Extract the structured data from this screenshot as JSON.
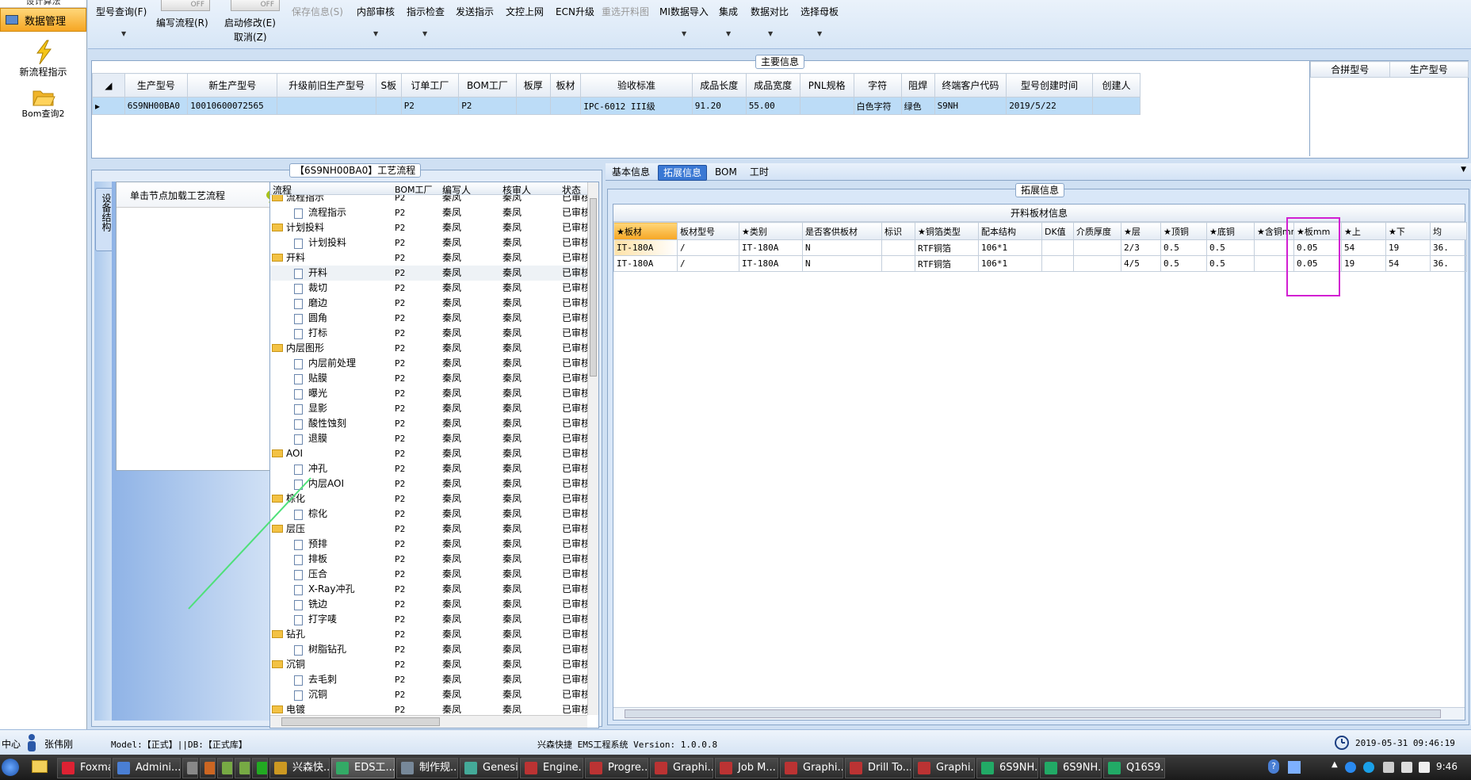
{
  "nav": {
    "top_label": "设计算法",
    "active_label": "数据管理",
    "new_flow_label": "新流程指示",
    "bom_query_label": "Bom查询2"
  },
  "toolbar": {
    "model_query": "型号查询(F)",
    "toggle_off": "OFF",
    "edit_flow": "编写流程(R)",
    "start_edit": "启动修改(E)",
    "cancel": "取消(Z)",
    "save_info": "保存信息(S)",
    "internal_review": "内部审核",
    "instruction_check": "指示检查",
    "send_instruction": "发送指示",
    "doc_upload": "文控上网",
    "ecn_upgrade": "ECN升级",
    "reselect_cut": "重选开料图",
    "mi_import": "MI数据导入",
    "integrate": "集成",
    "data_compare": "数据对比",
    "select_master": "选择母板"
  },
  "main_info": {
    "title": "主要信息",
    "columns": [
      "生产型号",
      "新生产型号",
      "升级前旧生产型号",
      "S板",
      "订单工厂",
      "BOM工厂",
      "板厚",
      "板材",
      "验收标准",
      "成品长度",
      "成品宽度",
      "PNL规格",
      "字符",
      "阻焊",
      "终端客户代码",
      "型号创建时间",
      "创建人"
    ],
    "row": [
      "6S9NH00BA0",
      "10010600072565",
      "",
      "",
      "P2",
      "P2",
      "",
      "",
      "IPC-6012 III级",
      "91.20",
      "55.00",
      "",
      "白色字符",
      "绿色",
      "S9NH",
      "2019/5/22",
      ""
    ],
    "side_columns": [
      "合拼型号",
      "生产型号"
    ]
  },
  "process": {
    "title": "【6S9NH00BA0】工艺流程",
    "side_tab": "设备结构",
    "hint": "单击节点加载工艺流程",
    "columns": [
      "流程",
      "BOM工厂",
      "编写人",
      "核审人",
      "状态"
    ],
    "rows": [
      {
        "level": 1,
        "type": "folder",
        "name": "流程指示",
        "factory": "P2",
        "writer": "秦凤",
        "reviewer": "秦凤",
        "status": "已审核"
      },
      {
        "level": 2,
        "type": "doc",
        "name": "流程指示",
        "factory": "P2",
        "writer": "秦凤",
        "reviewer": "秦凤",
        "status": "已审核"
      },
      {
        "level": 1,
        "type": "folder",
        "name": "计划投料",
        "factory": "P2",
        "writer": "秦凤",
        "reviewer": "秦凤",
        "status": "已审核"
      },
      {
        "level": 2,
        "type": "doc",
        "name": "计划投料",
        "factory": "P2",
        "writer": "秦凤",
        "reviewer": "秦凤",
        "status": "已审核"
      },
      {
        "level": 1,
        "type": "folder",
        "name": "开料",
        "factory": "P2",
        "writer": "秦凤",
        "reviewer": "秦凤",
        "status": "已审核"
      },
      {
        "level": 2,
        "type": "doc",
        "name": "开料",
        "factory": "P2",
        "writer": "秦凤",
        "reviewer": "秦凤",
        "status": "已审核",
        "selected": true
      },
      {
        "level": 2,
        "type": "doc",
        "name": "裁切",
        "factory": "P2",
        "writer": "秦凤",
        "reviewer": "秦凤",
        "status": "已审核"
      },
      {
        "level": 2,
        "type": "doc",
        "name": "磨边",
        "factory": "P2",
        "writer": "秦凤",
        "reviewer": "秦凤",
        "status": "已审核"
      },
      {
        "level": 2,
        "type": "doc",
        "name": "圆角",
        "factory": "P2",
        "writer": "秦凤",
        "reviewer": "秦凤",
        "status": "已审核"
      },
      {
        "level": 2,
        "type": "doc",
        "name": "打标",
        "factory": "P2",
        "writer": "秦凤",
        "reviewer": "秦凤",
        "status": "已审核"
      },
      {
        "level": 1,
        "type": "folder",
        "name": "内层图形",
        "factory": "P2",
        "writer": "秦凤",
        "reviewer": "秦凤",
        "status": "已审核"
      },
      {
        "level": 2,
        "type": "doc",
        "name": "内层前处理",
        "factory": "P2",
        "writer": "秦凤",
        "reviewer": "秦凤",
        "status": "已审核"
      },
      {
        "level": 2,
        "type": "doc",
        "name": "贴膜",
        "factory": "P2",
        "writer": "秦凤",
        "reviewer": "秦凤",
        "status": "已审核"
      },
      {
        "level": 2,
        "type": "doc",
        "name": "曝光",
        "factory": "P2",
        "writer": "秦凤",
        "reviewer": "秦凤",
        "status": "已审核"
      },
      {
        "level": 2,
        "type": "doc",
        "name": "显影",
        "factory": "P2",
        "writer": "秦凤",
        "reviewer": "秦凤",
        "status": "已审核"
      },
      {
        "level": 2,
        "type": "doc",
        "name": "酸性蚀刻",
        "factory": "P2",
        "writer": "秦凤",
        "reviewer": "秦凤",
        "status": "已审核"
      },
      {
        "level": 2,
        "type": "doc",
        "name": "退膜",
        "factory": "P2",
        "writer": "秦凤",
        "reviewer": "秦凤",
        "status": "已审核"
      },
      {
        "level": 1,
        "type": "folder",
        "name": "AOI",
        "factory": "P2",
        "writer": "秦凤",
        "reviewer": "秦凤",
        "status": "已审核"
      },
      {
        "level": 2,
        "type": "doc",
        "name": "冲孔",
        "factory": "P2",
        "writer": "秦凤",
        "reviewer": "秦凤",
        "status": "已审核"
      },
      {
        "level": 2,
        "type": "doc",
        "name": "内层AOI",
        "factory": "P2",
        "writer": "秦凤",
        "reviewer": "秦凤",
        "status": "已审核"
      },
      {
        "level": 1,
        "type": "folder",
        "name": "棕化",
        "factory": "P2",
        "writer": "秦凤",
        "reviewer": "秦凤",
        "status": "已审核"
      },
      {
        "level": 2,
        "type": "doc",
        "name": "棕化",
        "factory": "P2",
        "writer": "秦凤",
        "reviewer": "秦凤",
        "status": "已审核"
      },
      {
        "level": 1,
        "type": "folder",
        "name": "层压",
        "factory": "P2",
        "writer": "秦凤",
        "reviewer": "秦凤",
        "status": "已审核"
      },
      {
        "level": 2,
        "type": "doc",
        "name": "预排",
        "factory": "P2",
        "writer": "秦凤",
        "reviewer": "秦凤",
        "status": "已审核"
      },
      {
        "level": 2,
        "type": "doc",
        "name": "排板",
        "factory": "P2",
        "writer": "秦凤",
        "reviewer": "秦凤",
        "status": "已审核"
      },
      {
        "level": 2,
        "type": "doc",
        "name": "压合",
        "factory": "P2",
        "writer": "秦凤",
        "reviewer": "秦凤",
        "status": "已审核"
      },
      {
        "level": 2,
        "type": "doc",
        "name": "X-Ray冲孔",
        "factory": "P2",
        "writer": "秦凤",
        "reviewer": "秦凤",
        "status": "已审核"
      },
      {
        "level": 2,
        "type": "doc",
        "name": "铣边",
        "factory": "P2",
        "writer": "秦凤",
        "reviewer": "秦凤",
        "status": "已审核"
      },
      {
        "level": 2,
        "type": "doc",
        "name": "打字唛",
        "factory": "P2",
        "writer": "秦凤",
        "reviewer": "秦凤",
        "status": "已审核"
      },
      {
        "level": 1,
        "type": "folder",
        "name": "钻孔",
        "factory": "P2",
        "writer": "秦凤",
        "reviewer": "秦凤",
        "status": "已审核"
      },
      {
        "level": 2,
        "type": "doc",
        "name": "树脂钻孔",
        "factory": "P2",
        "writer": "秦凤",
        "reviewer": "秦凤",
        "status": "已审核"
      },
      {
        "level": 1,
        "type": "folder",
        "name": "沉铜",
        "factory": "P2",
        "writer": "秦凤",
        "reviewer": "秦凤",
        "status": "已审核"
      },
      {
        "level": 2,
        "type": "doc",
        "name": "去毛刺",
        "factory": "P2",
        "writer": "秦凤",
        "reviewer": "秦凤",
        "status": "已审核"
      },
      {
        "level": 2,
        "type": "doc",
        "name": "沉铜",
        "factory": "P2",
        "writer": "秦凤",
        "reviewer": "秦凤",
        "status": "已审核"
      },
      {
        "level": 1,
        "type": "folder",
        "name": "电镀",
        "factory": "P2",
        "writer": "秦凤",
        "reviewer": "秦凤",
        "status": "已审核"
      }
    ]
  },
  "tabs": [
    "基本信息",
    "拓展信息",
    "BOM",
    "工时"
  ],
  "active_tab": 1,
  "ext": {
    "group_title": "拓展信息",
    "table_title": "开料板材信息",
    "columns": [
      "★板材",
      "板材型号",
      "★类别",
      "是否客供板材",
      "标识",
      "★铜箔类型",
      "配本结构",
      "DK值",
      "介质厚度",
      "★层",
      "★顶铜",
      "★底铜",
      "★含铜mm",
      "★板mm",
      "★上",
      "★下",
      "均"
    ],
    "rows": [
      [
        "IT-180A",
        "/",
        "IT-180A",
        "N",
        "",
        "RTF铜箔",
        "106*1",
        "",
        "",
        "2/3",
        "0.5",
        "0.5",
        "",
        "0.05",
        "54",
        "19",
        "36."
      ],
      [
        "IT-180A",
        "/",
        "IT-180A",
        "N",
        "",
        "RTF铜箔",
        "106*1",
        "",
        "",
        "4/5",
        "0.5",
        "0.5",
        "",
        "0.05",
        "19",
        "54",
        "36."
      ]
    ]
  },
  "status": {
    "left": "中心",
    "user": "张伟刚",
    "model_db": "Model:【正式】||DB:【正式库】",
    "system": "兴森快捷 EMS工程系统 Version: 1.0.0.8",
    "datetime": "2019-05-31 09:46:19"
  },
  "taskbar": {
    "items": [
      "Foxmail",
      "Admini...",
      "",
      "",
      "",
      "",
      "",
      "兴森快...",
      "EDS工...",
      "制作规...",
      "Genesis",
      "Engine...",
      "Progre...",
      "Graphi...",
      "Job M...",
      "Graphi...",
      "Drill To...",
      "Graphi...",
      "6S9NH...",
      "6S9NH...",
      "Q16S9..."
    ],
    "clock": "9:46"
  },
  "colors": {
    "accent": "#f6a623",
    "selected_row": "#bcdcf7",
    "highlight_box": "#d21fd2",
    "tab_active": "#3a78d4"
  }
}
